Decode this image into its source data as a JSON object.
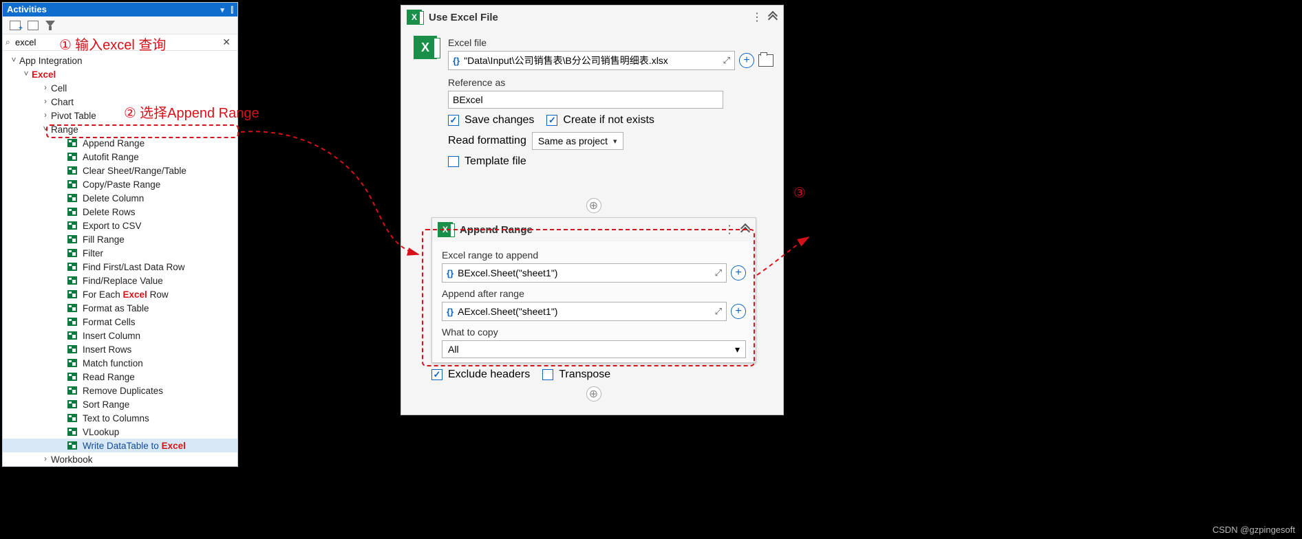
{
  "activities": {
    "title": "Activities",
    "search_value": "excel",
    "tree": {
      "root": "App Integration",
      "excel": "Excel",
      "nodes": {
        "cell": "Cell",
        "chart": "Chart",
        "pivot": "Pivot Table",
        "range": "Range",
        "workbook": "Workbook"
      },
      "range_items": [
        "Append Range",
        "Autofit Range",
        "Clear Sheet/Range/Table",
        "Copy/Paste Range",
        "Delete Column",
        "Delete Rows",
        "Export to CSV",
        "Fill Range",
        "Filter",
        "Find First/Last Data Row",
        "Find/Replace Value",
        "For Each Excel Row",
        "Format as Table",
        "Format Cells",
        "Insert Column",
        "Insert Rows",
        "Match function",
        "Read Range",
        "Remove Duplicates",
        "Sort Range",
        "Text to Columns",
        "VLookup",
        "Write DataTable to Excel"
      ],
      "for_each_pre": "For Each ",
      "for_each_suf": " Row",
      "write_dt_pre": "Write DataTable to ",
      "hi_word": "Excel"
    }
  },
  "use_excel": {
    "title": "Use Excel File",
    "label_file": "Excel file",
    "path_expr": "\"Data\\Input\\公司销售表\\B分公司销售明细表.xlsx",
    "label_ref": "Reference as",
    "ref_value": "BExcel",
    "chk_save": "Save changes",
    "chk_create": "Create if not exists",
    "label_readfmt": "Read formatting",
    "readfmt_value": "Same as project",
    "chk_template": "Template file"
  },
  "append": {
    "title": "Append Range",
    "label_range": "Excel range to append",
    "range_expr": "BExcel.Sheet(\"sheet1\")",
    "label_after": "Append after range",
    "after_expr": "AExcel.Sheet(\"sheet1\")",
    "label_what": "What to copy",
    "what_value": "All",
    "chk_exclude": "Exclude headers",
    "chk_transpose": "Transpose"
  },
  "annotations": {
    "a1": "输入excel 查询",
    "a2": "选择Append Range",
    "n1": "①",
    "n2": "②",
    "n3": "③"
  },
  "watermark": "CSDN @gzpingesoft"
}
